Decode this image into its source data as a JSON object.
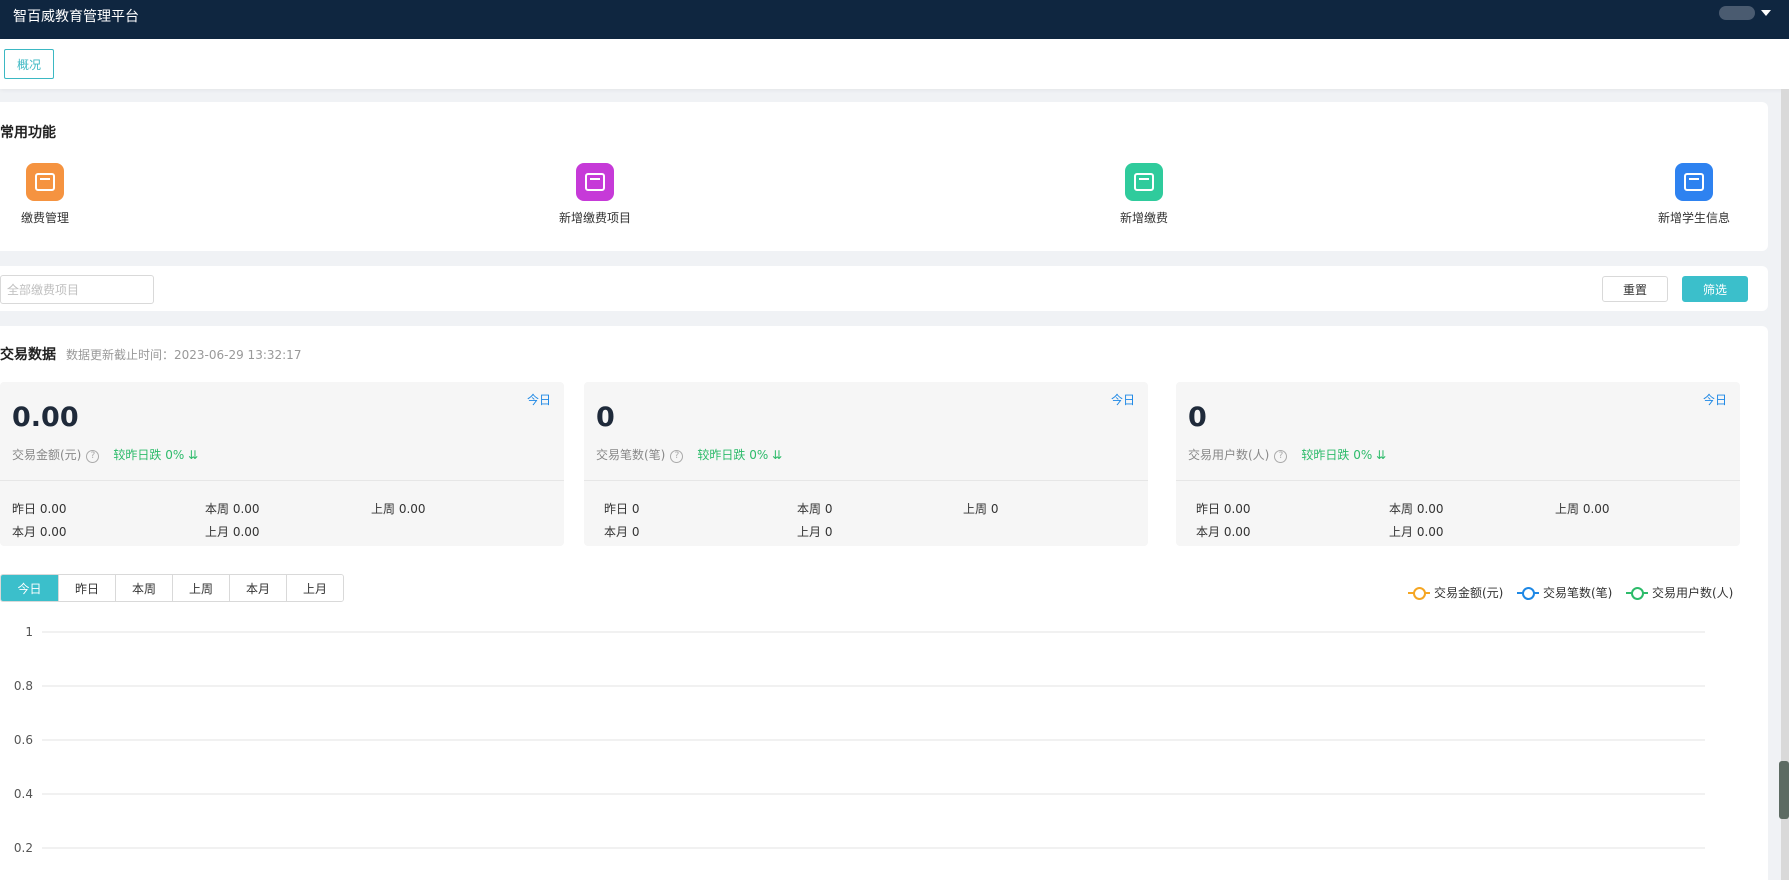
{
  "header": {
    "title": "智百威教育管理平台"
  },
  "tabs": [
    {
      "label": "概况"
    }
  ],
  "functions": {
    "title": "常用功能",
    "items": [
      {
        "label": "缴费管理",
        "icon": "fee-management-icon",
        "color": "#f59340"
      },
      {
        "label": "新增缴费项目",
        "icon": "add-fee-item-icon",
        "color": "#c63ad8"
      },
      {
        "label": "新增缴费",
        "icon": "add-payment-icon",
        "color": "#2fcb9c"
      },
      {
        "label": "新增学生信息",
        "icon": "add-student-icon",
        "color": "#2e82f0"
      }
    ]
  },
  "filter": {
    "placeholder": "全部缴费项目",
    "reset_label": "重置",
    "filter_label": "筛选"
  },
  "transactions": {
    "title": "交易数据",
    "updated": "数据更新截止时间：2023-06-29 13:32:17",
    "cards": [
      {
        "value": "0.00",
        "metric": "交易金额(元)",
        "today": "今日",
        "trend": "较昨日跌 0% ⇊",
        "yesterday": "昨日 0.00",
        "this_week": "本周 0.00",
        "last_week": "上周 0.00",
        "this_month": "本月 0.00",
        "last_month": "上月 0.00"
      },
      {
        "value": "0",
        "metric": "交易笔数(笔)",
        "today": "今日",
        "trend": "较昨日跌 0% ⇊",
        "yesterday": "昨日 0",
        "this_week": "本周 0",
        "last_week": "上周 0",
        "this_month": "本月 0",
        "last_month": "上月 0"
      },
      {
        "value": "0",
        "metric": "交易用户数(人)",
        "today": "今日",
        "trend": "较昨日跌 0% ⇊",
        "yesterday": "昨日 0.00",
        "this_week": "本周 0.00",
        "last_week": "上周 0.00",
        "this_month": "本月 0.00",
        "last_month": "上月 0.00"
      }
    ],
    "periods": [
      "今日",
      "昨日",
      "本周",
      "上周",
      "本月",
      "上月"
    ],
    "active_period": "今日"
  },
  "chart_data": {
    "type": "line",
    "series": [
      {
        "name": "交易金额(元)",
        "color": "#f5a623",
        "values": []
      },
      {
        "name": "交易笔数(笔)",
        "color": "#1e88e5",
        "values": []
      },
      {
        "name": "交易用户数(人)",
        "color": "#2dbb6a",
        "values": []
      }
    ],
    "yticks": [
      "1",
      "0.8",
      "0.6",
      "0.4",
      "0.2"
    ],
    "ylim": [
      0,
      1
    ],
    "grid": true,
    "legend": "top-right"
  }
}
